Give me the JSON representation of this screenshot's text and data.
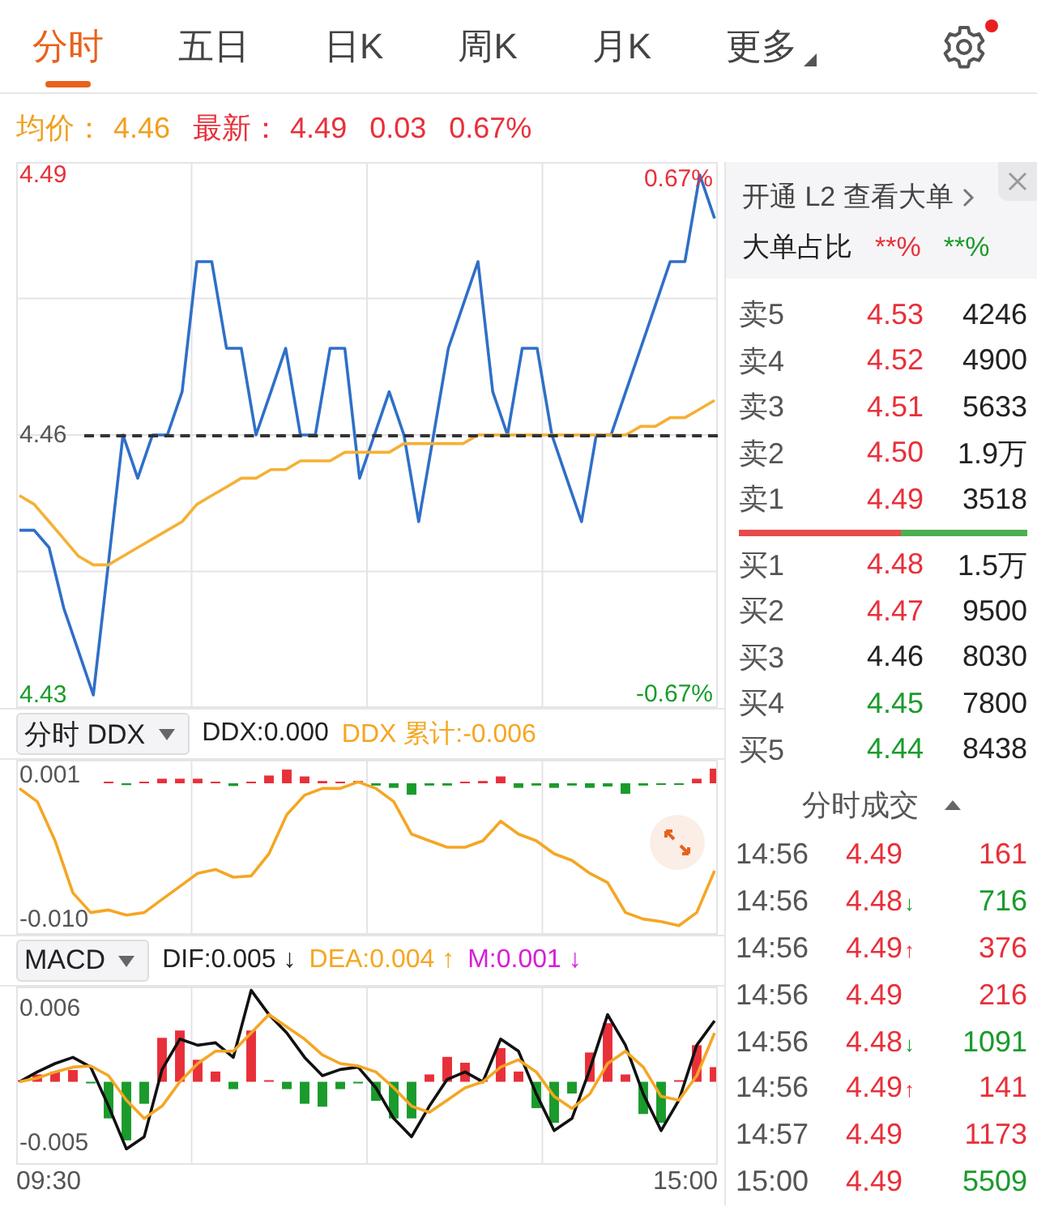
{
  "tabs": [
    {
      "label": "分时",
      "selected": true,
      "has_menu": false
    },
    {
      "label": "五日",
      "selected": false,
      "has_menu": false
    },
    {
      "label": "日K",
      "selected": false,
      "has_menu": false
    },
    {
      "label": "周K",
      "selected": false,
      "has_menu": false
    },
    {
      "label": "月K",
      "selected": false,
      "has_menu": false
    },
    {
      "label": "更多",
      "selected": false,
      "has_menu": true
    }
  ],
  "settings": {
    "badge": true
  },
  "quote": {
    "avg_label": "均价：",
    "avg": "4.46",
    "last_label": "最新：",
    "last": "4.49",
    "change": "0.03",
    "change_pct": "0.67%"
  },
  "price_panel": {
    "percent_high": "0.67%",
    "percent_low": "-0.67%",
    "prev_close_line": true,
    "chart_data": {
      "type": "line",
      "ylim": [
        4.4285,
        4.4915
      ],
      "yticks": [
        {
          "value": 4.49,
          "label": "4.49"
        },
        {
          "value": 4.46,
          "label": "4.46"
        },
        {
          "value": 4.43,
          "label": "4.43"
        }
      ],
      "series": [
        {
          "color": "#2f6fc8",
          "values": [
            4.449,
            4.449,
            4.447,
            4.44,
            4.435,
            4.43,
            4.445,
            4.46,
            4.455,
            4.46,
            4.46,
            4.465,
            4.48,
            4.48,
            4.47,
            4.47,
            4.46,
            4.465,
            4.47,
            4.46,
            4.46,
            4.47,
            4.47,
            4.455,
            4.46,
            4.465,
            4.46,
            4.45,
            4.46,
            4.47,
            4.475,
            4.48,
            4.465,
            4.46,
            4.47,
            4.47,
            4.46,
            4.455,
            4.45,
            4.46,
            4.46,
            4.465,
            4.47,
            4.475,
            4.48,
            4.48,
            4.49,
            4.485
          ]
        },
        {
          "color": "#f5b035",
          "values": [
            4.453,
            4.452,
            4.45,
            4.448,
            4.446,
            4.445,
            4.445,
            4.446,
            4.447,
            4.448,
            4.449,
            4.45,
            4.452,
            4.453,
            4.454,
            4.455,
            4.455,
            4.456,
            4.456,
            4.457,
            4.457,
            4.457,
            4.458,
            4.458,
            4.458,
            4.458,
            4.459,
            4.459,
            4.459,
            4.459,
            4.459,
            4.46,
            4.46,
            4.46,
            4.46,
            4.46,
            4.46,
            4.46,
            4.46,
            4.46,
            4.46,
            4.46,
            4.461,
            4.461,
            4.462,
            4.462,
            4.463,
            4.464
          ]
        }
      ]
    }
  },
  "ddx_bar": {
    "selector": "分时 DDX",
    "indicators": [
      {
        "text": "DDX:0.000",
        "color": "#222222"
      },
      {
        "text": "DDX 累计:-0.006",
        "color": "#f5a623"
      }
    ]
  },
  "ddx_panel": {
    "chart_data": {
      "type": "line",
      "ylim": [
        -0.0112,
        0.0022
      ],
      "yticks": [
        {
          "value": 0.001,
          "label": "0.001"
        },
        {
          "value": -0.01,
          "label": "-0.010"
        }
      ],
      "series": [
        {
          "color": "#f5a623",
          "values": [
            0,
            -0.001,
            -0.004,
            -0.008,
            -0.0095,
            -0.0093,
            -0.0097,
            -0.0095,
            -0.0085,
            -0.0075,
            -0.0065,
            -0.0062,
            -0.0068,
            -0.0067,
            -0.005,
            -0.002,
            -0.0005,
            0,
            0,
            0.0005,
            0,
            -0.001,
            -0.0035,
            -0.004,
            -0.0045,
            -0.0045,
            -0.004,
            -0.0025,
            -0.0035,
            -0.004,
            -0.005,
            -0.0055,
            -0.0065,
            -0.0072,
            -0.0095,
            -0.01,
            -0.0102,
            -0.0105,
            -0.0095,
            -0.0063
          ]
        }
      ]
    }
  },
  "macd_bar": {
    "selector": "MACD",
    "indicators": [
      {
        "text": "DIF:0.005 ↓",
        "color": "#222222"
      },
      {
        "text": "DEA:0.004 ↑",
        "color": "#f5a623"
      },
      {
        "text": "M:0.001 ↓",
        "color": "#d61fd6"
      }
    ]
  },
  "macd_panel": {
    "time_start": "09:30",
    "time_end": "15:00",
    "chart_data": {
      "type": "line",
      "ylim": [
        -0.0068,
        0.0078
      ],
      "yticks": [
        {
          "value": 0.006,
          "label": "0.006"
        },
        {
          "value": -0.005,
          "label": "-0.005"
        }
      ],
      "series": [
        {
          "color": "#111111",
          "values": [
            0,
            0.0008,
            0.0015,
            0.002,
            0.0012,
            -0.002,
            -0.0055,
            -0.0045,
            0.001,
            0.0035,
            0.003,
            0.0032,
            0.002,
            0.0075,
            0.0055,
            0.004,
            0.002,
            0.0005,
            0.001,
            0.0012,
            -0.0005,
            -0.003,
            -0.0045,
            -0.002,
            0.0002,
            0.0008,
            0,
            0.0035,
            0.0025,
            -0.001,
            -0.004,
            -0.003,
            0.001,
            0.0055,
            0.003,
            -0.001,
            -0.004,
            -0.0015,
            0.003,
            0.005
          ]
        },
        {
          "color": "#f5a623",
          "values": [
            0,
            0.0003,
            0.0008,
            0.0012,
            0.0013,
            0.0005,
            -0.0015,
            -0.003,
            -0.002,
            0,
            0.0015,
            0.0025,
            0.0025,
            0.004,
            0.0055,
            0.0045,
            0.0035,
            0.0022,
            0.0015,
            0.0013,
            0.0008,
            -0.0005,
            -0.002,
            -0.0025,
            -0.0015,
            -0.0005,
            0,
            0.0012,
            0.0018,
            0.0008,
            -0.0012,
            -0.0022,
            -0.001,
            0.0015,
            0.0025,
            0.0012,
            -0.0012,
            -0.0015,
            0.0005,
            0.004
          ]
        }
      ]
    }
  },
  "order_book": {
    "promo_link": "开通 L2 查看大单",
    "ratio_label": "大单占比",
    "ratio_buy": "**%",
    "ratio_sell": "**%",
    "asks": [
      {
        "label": "卖5",
        "price": "4.53",
        "volume": "4246",
        "color": "#e8303a"
      },
      {
        "label": "卖4",
        "price": "4.52",
        "volume": "4900",
        "color": "#e8303a"
      },
      {
        "label": "卖3",
        "price": "4.51",
        "volume": "5633",
        "color": "#e8303a"
      },
      {
        "label": "卖2",
        "price": "4.50",
        "volume": "1.9万",
        "color": "#e8303a"
      },
      {
        "label": "卖1",
        "price": "4.49",
        "volume": "3518",
        "color": "#e8303a"
      }
    ],
    "balance": {
      "level": 0.56
    },
    "bids": [
      {
        "label": "买1",
        "price": "4.48",
        "volume": "1.5万",
        "color": "#e8303a"
      },
      {
        "label": "买2",
        "price": "4.47",
        "volume": "9500",
        "color": "#e8303a"
      },
      {
        "label": "买3",
        "price": "4.46",
        "volume": "8030",
        "color": "#222222"
      },
      {
        "label": "买4",
        "price": "4.45",
        "volume": "7800",
        "color": "#1a9b2c"
      },
      {
        "label": "买5",
        "price": "4.44",
        "volume": "8438",
        "color": "#1a9b2c"
      }
    ]
  },
  "trades": {
    "title": "分时成交",
    "items": [
      {
        "time": "14:56",
        "price": {
          "text": "4.49",
          "color": "#e8303a"
        },
        "volume": {
          "text": "161",
          "color": "#e8303a"
        }
      },
      {
        "time": "14:56",
        "price": {
          "text": "4.48",
          "color": "#e8303a"
        },
        "arrow": {
          "text": "↓",
          "color": "#1a9b2c"
        },
        "volume": {
          "text": "716",
          "color": "#1a9b2c"
        }
      },
      {
        "time": "14:56",
        "price": {
          "text": "4.49",
          "color": "#e8303a"
        },
        "arrow": {
          "text": "↑",
          "color": "#e8303a"
        },
        "volume": {
          "text": "376",
          "color": "#e8303a"
        }
      },
      {
        "time": "14:56",
        "price": {
          "text": "4.49",
          "color": "#e8303a"
        },
        "volume": {
          "text": "216",
          "color": "#e8303a"
        }
      },
      {
        "time": "14:56",
        "price": {
          "text": "4.48",
          "color": "#e8303a"
        },
        "arrow": {
          "text": "↓",
          "color": "#1a9b2c"
        },
        "volume": {
          "text": "1091",
          "color": "#1a9b2c"
        }
      },
      {
        "time": "14:56",
        "price": {
          "text": "4.49",
          "color": "#e8303a"
        },
        "arrow": {
          "text": "↑",
          "color": "#e8303a"
        },
        "volume": {
          "text": "141",
          "color": "#e8303a"
        }
      },
      {
        "time": "14:57",
        "price": {
          "text": "4.49",
          "color": "#e8303a"
        },
        "volume": {
          "text": "1173",
          "color": "#e8303a"
        }
      },
      {
        "time": "15:00",
        "price": {
          "text": "4.49",
          "color": "#e8303a"
        },
        "volume": {
          "text": "5509",
          "color": "#1a9b2c"
        }
      }
    ]
  }
}
